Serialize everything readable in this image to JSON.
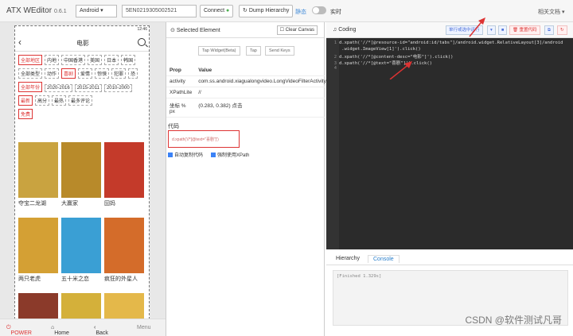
{
  "top": {
    "brand": "ATX WEditor",
    "version": "0.6.1",
    "platform": "Android",
    "serial": "5EN0219305002521",
    "connect": "Connect",
    "dump": "Dump Hierarchy",
    "static": "静态",
    "realtime": "实时",
    "docs": "相关文档"
  },
  "phone": {
    "time": "12:46",
    "title": "电影",
    "filters": [
      {
        "items": [
          "全部地区",
          "内地",
          "中国香港",
          "美国",
          "日本",
          "韩国"
        ],
        "selected": 0
      },
      {
        "items": [
          "全部类型",
          "动作",
          "喜剧",
          "爱情",
          "惊悚",
          "犯罪",
          "恐"
        ],
        "selected": 2
      },
      {
        "items": [
          "全部年份",
          "2020-2016",
          "2015-2011",
          "2010-2000"
        ],
        "selected": 0
      },
      {
        "items": [
          "最新",
          "高分",
          "最热",
          "最多评论"
        ],
        "selected": 0
      },
      {
        "items": [
          "免费"
        ],
        "selected": 0
      }
    ],
    "movies": [
      "夺宝二龙湖",
      "大赢家",
      "囧妈",
      "两只老虎",
      "五十米之恋",
      "疯狂的外星人",
      "",
      "",
      ""
    ],
    "nav": {
      "power": "POWER",
      "home": "Home",
      "back": "Back",
      "menu": "Menu"
    }
  },
  "mid": {
    "title": "Selected Element",
    "clear": "Clear Canvas",
    "btns": [
      "Tap Widget(Beta)",
      "Tap",
      "Send Keys"
    ],
    "table": {
      "head": [
        "Prop",
        "Value"
      ],
      "rows": [
        [
          "activity",
          "com.ss.android.xiagualongvideo.LongVideoFilterActivity"
        ],
        [
          "XPathLite",
          "//"
        ],
        [
          "坐标 % px",
          "(0.283, 0.382) 点击"
        ]
      ]
    },
    "code_label": "代码",
    "code": "d.xpath('//*[@text=\"喜剧\"]')",
    "cb1": "自动复制代码",
    "cb2": "强制使用XPath"
  },
  "right": {
    "title": "Coding",
    "run_sel": "单行或选中运行",
    "reset": "重置代码",
    "code_lines": [
      "d.xpath('//*[@resource-id=\"android:id/tabs\"]/android.widget.RelativeLayout[3]/android",
      "    .widget.ImageView[1]').click()",
      "d.xpath('//*[@content-desc=\"电影\"]').click()",
      "d.xpath('//*[@text=\"喜剧\"]').click()",
      ""
    ],
    "gutter": [
      "1",
      "",
      "2",
      "3",
      "4"
    ],
    "tabs": [
      "Hierarchy",
      "Console"
    ],
    "console": "[Finished 1.329s]"
  },
  "watermark": "CSDN @软件测试凡哥",
  "colors": {
    "accent": "#3b82f6",
    "highlight": "#d33",
    "editor_bg": "#2b2b2b"
  }
}
